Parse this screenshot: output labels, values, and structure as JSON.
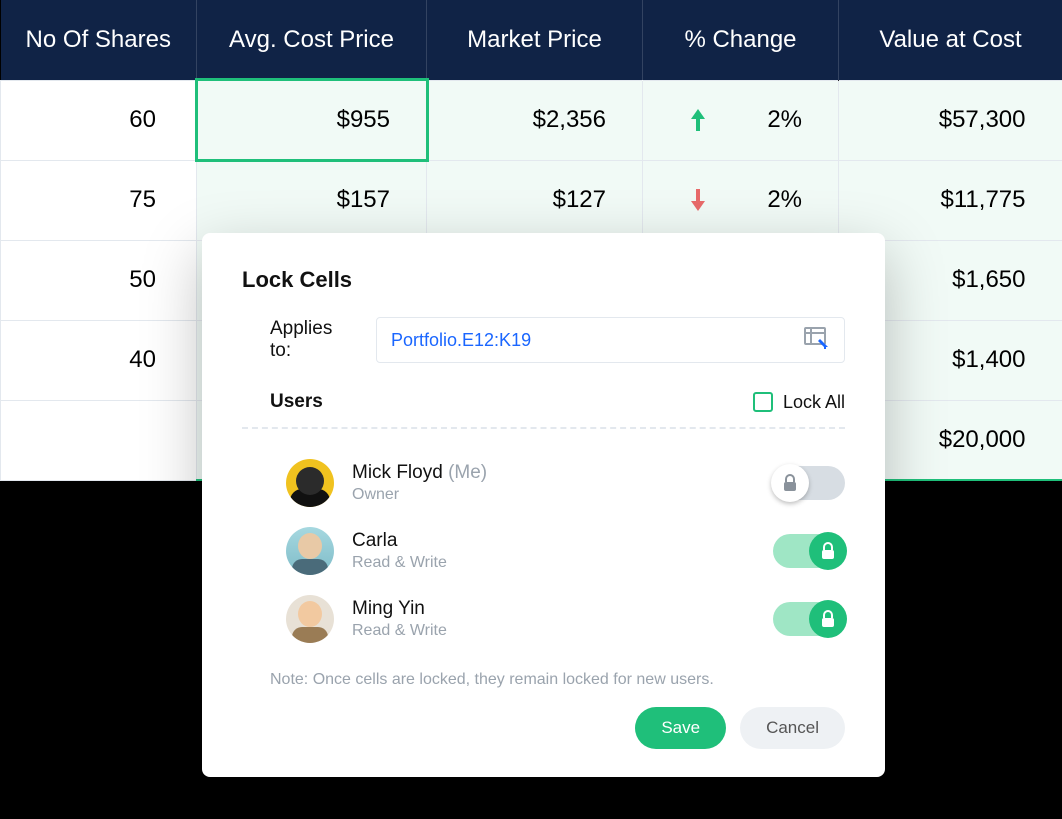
{
  "table": {
    "headers": {
      "shares": "No Of Shares",
      "cost": "Avg. Cost Price",
      "market": "Market Price",
      "change": "% Change",
      "value": "Value at Cost"
    },
    "rows": [
      {
        "shares": "60",
        "cost": "$955",
        "market": "$2,356",
        "change_dir": "up",
        "change": "2%",
        "value": "$57,300"
      },
      {
        "shares": "75",
        "cost": "$157",
        "market": "$127",
        "change_dir": "down",
        "change": "2%",
        "value": "$11,775"
      },
      {
        "shares": "50",
        "cost": "",
        "market": "",
        "change_dir": "",
        "change": "",
        "value": "$1,650"
      },
      {
        "shares": "40",
        "cost": "",
        "market": "",
        "change_dir": "",
        "change": "",
        "value": "$1,400"
      },
      {
        "shares": "",
        "cost": "",
        "market": "",
        "change_dir": "",
        "change": "",
        "value": "$20,000"
      }
    ]
  },
  "dialog": {
    "title": "Lock Cells",
    "applies_label": "Applies to:",
    "range": "Portfolio.E12:K19",
    "users_label": "Users",
    "lock_all_label": "Lock All",
    "users": [
      {
        "name": "Mick Floyd",
        "suffix": "(Me)",
        "role": "Owner",
        "locked": false
      },
      {
        "name": "Carla",
        "suffix": "",
        "role": "Read & Write",
        "locked": true
      },
      {
        "name": "Ming Yin",
        "suffix": "",
        "role": "Read & Write",
        "locked": true
      }
    ],
    "note": "Note: Once cells are locked, they remain locked for new users.",
    "save": "Save",
    "cancel": "Cancel"
  }
}
